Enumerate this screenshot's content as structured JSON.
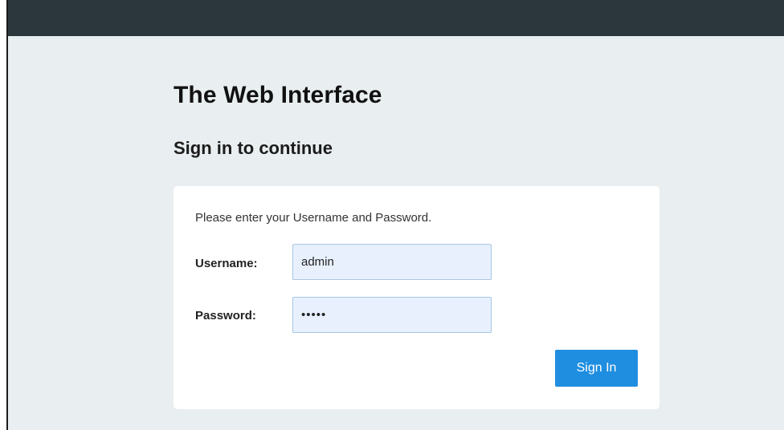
{
  "header": {
    "app_title": "The Web Interface",
    "subtitle": "Sign in to continue"
  },
  "form": {
    "prompt": "Please enter your Username and Password.",
    "username_label": "Username:",
    "username_value": "admin",
    "password_label": "Password:",
    "password_value": "admin",
    "submit_label": "Sign In"
  },
  "colors": {
    "page_background": "#e9eef0",
    "top_bar": "#2b373d",
    "card_background": "#ffffff",
    "input_background": "#e8f0fe",
    "button_background": "#1f8ee0"
  }
}
